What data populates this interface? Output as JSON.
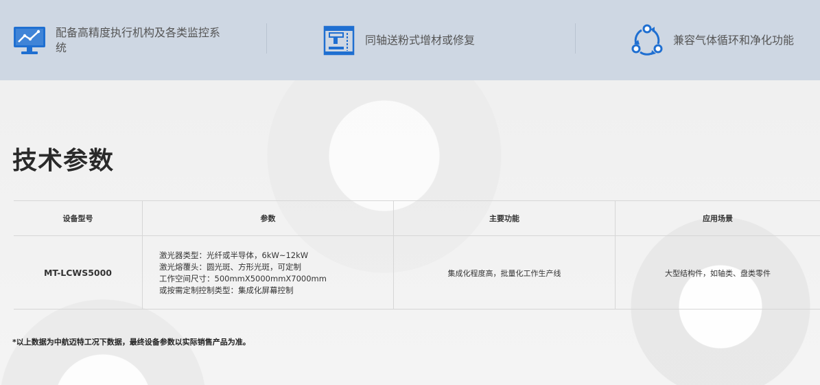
{
  "features": [
    {
      "icon": "monitor-chart-icon",
      "text": "配备高精度执行机构及各类监控系统"
    },
    {
      "icon": "machine-tool-icon",
      "text": "同轴送粉式增材或修复"
    },
    {
      "icon": "cycle-arrows-icon",
      "text": "兼容气体循环和净化功能"
    }
  ],
  "section_title": "技术参数",
  "table": {
    "headers": [
      "设备型号",
      "参数",
      "主要功能",
      "应用场景"
    ],
    "rows": [
      {
        "model": "MT-LCWS5000",
        "params": [
          "激光器类型：光纤或半导体，6kW~12kW",
          "激光熔覆头：圆光斑、方形光斑，可定制",
          "工作空间尺寸：500mmX5000mmX7000mm",
          "或按需定制控制类型：集成化屏幕控制"
        ],
        "function": "集成化程度高，批量化工作生产线",
        "application": "大型结构件，如轴类、盘类零件"
      }
    ]
  },
  "footnote": "*以上数据为中航迈特工况下数据，最终设备参数以实际销售产品为准。",
  "colors": {
    "icon_blue": "#1f6fd1",
    "banner_bg": "#ced7e3"
  }
}
